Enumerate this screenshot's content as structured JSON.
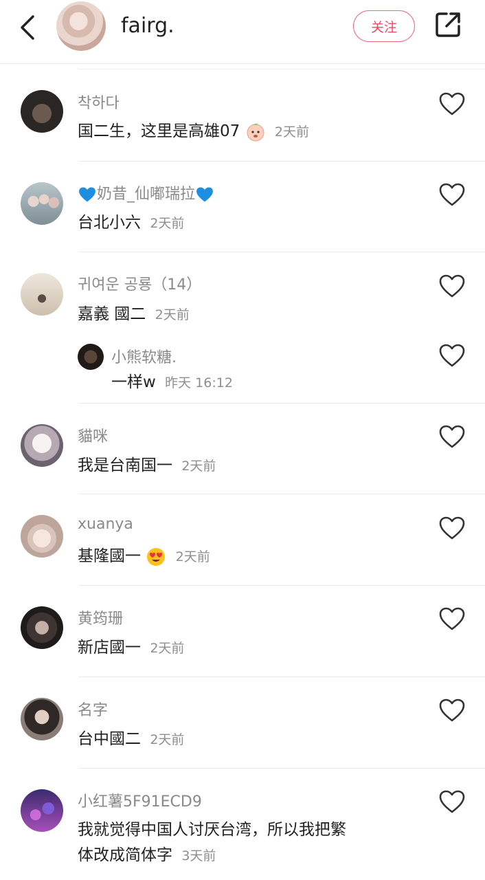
{
  "header": {
    "username": "fairg.",
    "follow_label": "关注",
    "back_icon": "chevron-left-icon",
    "share_icon": "share-external-icon"
  },
  "colors": {
    "accent": "#e84a5f",
    "heart_outline": "#333333",
    "blue_heart": "#1e8fe0"
  },
  "comments": [
    {
      "name": "착하다",
      "text": "国二生，这里是高雄07",
      "time": "2天前",
      "emoji": "peach-face-emoji"
    },
    {
      "name": "奶昔_仙嘟瑞拉",
      "text": "台北小六",
      "time": "2天前",
      "name_emoji": "blue-heart-emoji"
    },
    {
      "name": "귀여운 공룡（14）",
      "text": "嘉義 國二",
      "time": "2天前"
    },
    {
      "name": "小熊软糖.",
      "text": "一样w",
      "time": "昨天 16:12",
      "reply": true
    },
    {
      "name": "貓咪",
      "text": "我是台南国一",
      "time": "2天前"
    },
    {
      "name": "xuanya",
      "text": "基隆國一",
      "time": "2天前",
      "emoji": "heart-eyes-emoji"
    },
    {
      "name": "黄筠珊",
      "text": "新店國一",
      "time": "2天前"
    },
    {
      "name": "名字",
      "text": "台中國二",
      "time": "2天前"
    },
    {
      "name": "小红薯5F91ECD9",
      "text": "我就觉得中国人讨厌台湾，所以我把繁",
      "text2": "体改成简体字",
      "time": "3天前"
    }
  ]
}
